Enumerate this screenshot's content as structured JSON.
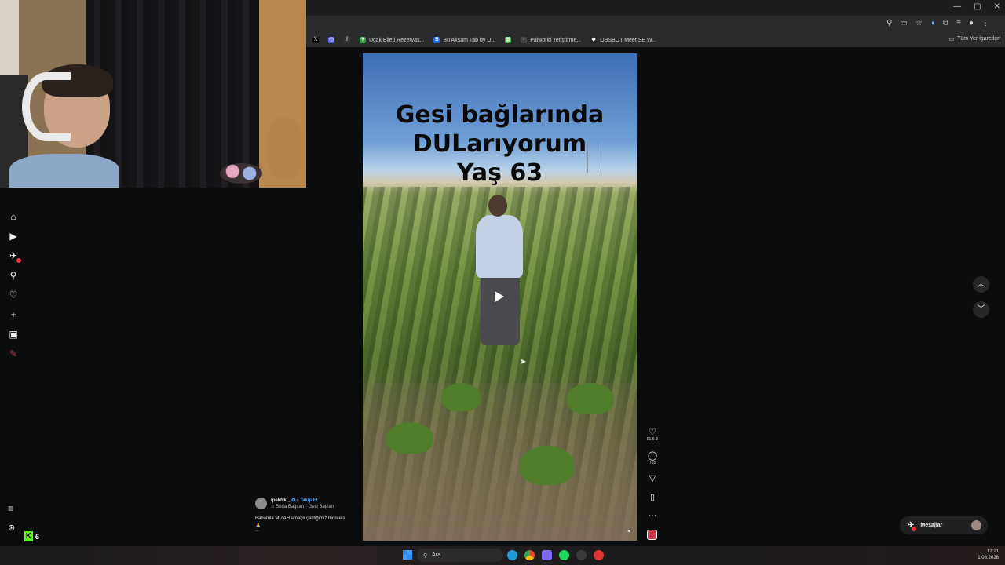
{
  "window": {
    "controls": [
      "—",
      "▢",
      "✕"
    ]
  },
  "bookmarks": {
    "items": [
      {
        "label": "",
        "icon": "x-icon",
        "glyph": "𝕏",
        "color": "#000000"
      },
      {
        "label": "",
        "icon": "circle-app-icon",
        "glyph": "◎",
        "color": "#5865f2"
      },
      {
        "label": "",
        "icon": "f-icon",
        "glyph": "f",
        "color": "#333333"
      },
      {
        "label": "Uçak Bileti Rezervas...",
        "icon": "plane-site-icon",
        "glyph": "✈",
        "color": "#2ea043"
      },
      {
        "label": "Bu Akşam Tab by D...",
        "icon": "b-site-icon",
        "glyph": "B",
        "color": "#1f6feb"
      },
      {
        "label": "",
        "icon": "green-site-icon",
        "glyph": "▦",
        "color": "#3fb950"
      },
      {
        "label": "Palworld Yetiştirme...",
        "icon": "pal-site-icon",
        "glyph": "·",
        "color": "#444444"
      },
      {
        "label": "OBSBOT Meet SE W...",
        "icon": "obsbot-site-icon",
        "glyph": "◆",
        "color": "#222222"
      }
    ],
    "all_bookmarks": "Tüm Yer İşaretleri"
  },
  "reel": {
    "caption_lines": [
      "Gesi bağlarında",
      "DULarıyorum",
      "Yaş 63"
    ]
  },
  "actions": {
    "likes": "61,6 B",
    "comments": "765"
  },
  "author": {
    "username": "ipektrkl_",
    "separator": "•",
    "follow": "Takip Et",
    "music": "♫ Seda Bağcan · Gesi Bağları",
    "description": "Babamla MİZAH amaçlı çektiğimiz bir reels",
    "emoji": "🙏",
    "more": "..."
  },
  "messages": {
    "label": "Mesajlar"
  },
  "kick": {
    "letter": "K",
    "count": "6"
  },
  "taskbar": {
    "search_placeholder": "Ara",
    "time": "12:21",
    "date": "1.08.2026"
  },
  "colors": {
    "background": "#0b0c0d",
    "accent_blue": "#4aa8ff",
    "notification_red": "#ff3040",
    "kick_green": "#53fc18"
  }
}
